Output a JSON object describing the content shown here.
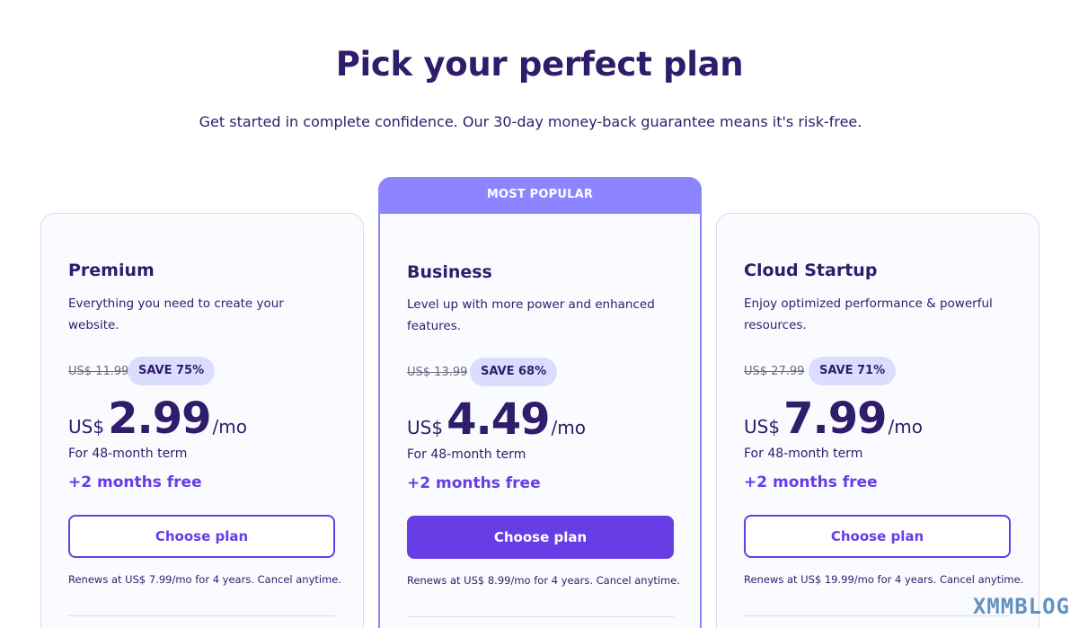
{
  "header": {
    "title": "Pick your perfect plan",
    "subtitle": "Get started in complete confidence. Our 30-day money-back guarantee means it's risk-free."
  },
  "plans": [
    {
      "name": "Premium",
      "description": "Everything you need to create your website.",
      "old_price": "US$ 11.99",
      "save": "SAVE 75%",
      "currency": "US$",
      "price": "2.99",
      "per": "/mo",
      "term": "For 48-month term",
      "bonus": "+2 months free",
      "button": "Choose plan",
      "renew": "Renews at US$ 7.99/mo for 4 years. Cancel anytime."
    },
    {
      "badge": "MOST POPULAR",
      "name": "Business",
      "description": "Level up with more power and enhanced features.",
      "old_price": "US$ 13.99",
      "save": "SAVE 68%",
      "currency": "US$",
      "price": "4.49",
      "per": "/mo",
      "term": "For 48-month term",
      "bonus": "+2 months free",
      "button": "Choose plan",
      "renew": "Renews at US$ 8.99/mo for 4 years. Cancel anytime."
    },
    {
      "name": "Cloud Startup",
      "description": "Enjoy optimized performance & powerful resources.",
      "old_price": "US$ 27.99",
      "save": "SAVE 71%",
      "currency": "US$",
      "price": "7.99",
      "per": "/mo",
      "term": "For 48-month term",
      "bonus": "+2 months free",
      "button": "Choose plan",
      "renew": "Renews at US$ 19.99/mo for 4 years. Cancel anytime."
    }
  ],
  "watermark": "XMMBLOG",
  "colors": {
    "primary": "#673de6",
    "popular_banner": "#8c85ff",
    "heading": "#2f1c6a",
    "badge_bg": "#dcdcff"
  }
}
